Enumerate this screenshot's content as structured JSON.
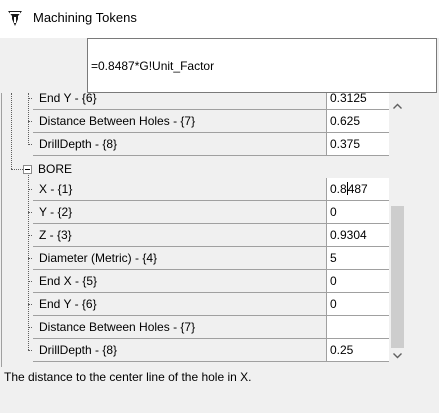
{
  "window": {
    "title": "Machining Tokens",
    "icon": "machining-tool-icon"
  },
  "formula": {
    "value": "=0.8487*G!Unit_Factor"
  },
  "grid": {
    "rows": [
      {
        "name": "End Y - {6}",
        "value": "0.3125"
      },
      {
        "name": "Distance Between Holes - {7}",
        "value": "0.625"
      },
      {
        "name": "DrillDepth - {8}",
        "value": "0.375"
      }
    ],
    "group": {
      "label": "BORE",
      "state": "expanded",
      "rows": [
        {
          "name": "X - {1}",
          "value_before_cursor": "0.8",
          "value_after_cursor": "487"
        },
        {
          "name": "Y - {2}",
          "value": "0"
        },
        {
          "name": "Z - {3}",
          "value": "0.9304"
        },
        {
          "name": "Diameter (Metric) - {4}",
          "value": "5"
        },
        {
          "name": "End X - {5}",
          "value": "0"
        },
        {
          "name": "End Y - {6}",
          "value": "0"
        },
        {
          "name": "Distance Between Holes - {7}",
          "value": ""
        },
        {
          "name": "DrillDepth - {8}",
          "value": "0.25"
        }
      ]
    }
  },
  "scrollbar": {
    "up_icon": "scroll-up-arrow-icon",
    "down_icon": "scroll-down-arrow-icon"
  },
  "status": {
    "text": "The distance to the center line of the hole in X."
  }
}
